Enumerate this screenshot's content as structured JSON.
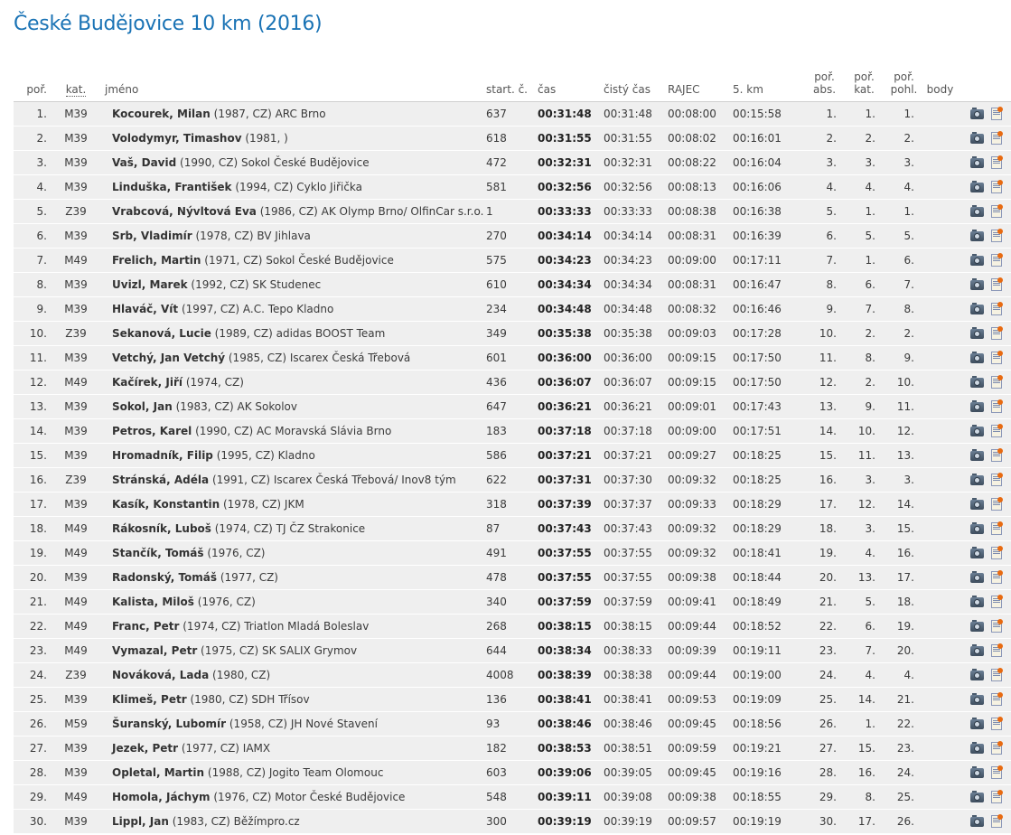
{
  "title": "České Budějovice 10 km (2016)",
  "headers": {
    "rank": "poř.",
    "category": "kat.",
    "name": "jméno",
    "start_no": "start. č.",
    "time": "čas",
    "net_time": "čistý čas",
    "rajec": "RAJEC",
    "km5": "5. km",
    "rank_abs_1": "poř.",
    "rank_abs_2": "abs.",
    "rank_cat_1": "poř.",
    "rank_cat_2": "kat.",
    "rank_gender_1": "poř.",
    "rank_gender_2": "pohl.",
    "points": "body"
  },
  "icons": {
    "photo": "camera-icon",
    "certificate": "certificate-icon"
  },
  "colors": {
    "title": "#1a73b5",
    "row_bg": "#efefef"
  },
  "rows": [
    {
      "rank": "1.",
      "cat": "M39",
      "name": "Kocourek, Milan",
      "info": " (1987, CZ) ARC Brno",
      "start": "637",
      "time": "00:31:48",
      "net": "00:31:48",
      "rajec": "00:08:00",
      "km5": "00:15:58",
      "abs": "1.",
      "katr": "1.",
      "pohl": "1."
    },
    {
      "rank": "2.",
      "cat": "M39",
      "name": "Volodymyr, Timashov",
      "info": " (1981, )",
      "start": "618",
      "time": "00:31:55",
      "net": "00:31:55",
      "rajec": "00:08:02",
      "km5": "00:16:01",
      "abs": "2.",
      "katr": "2.",
      "pohl": "2."
    },
    {
      "rank": "3.",
      "cat": "M39",
      "name": "Vaš, David",
      "info": " (1990, CZ) Sokol České Budějovice",
      "start": "472",
      "time": "00:32:31",
      "net": "00:32:31",
      "rajec": "00:08:22",
      "km5": "00:16:04",
      "abs": "3.",
      "katr": "3.",
      "pohl": "3."
    },
    {
      "rank": "4.",
      "cat": "M39",
      "name": "Linduška, František",
      "info": " (1994, CZ) Cyklo Jiřička",
      "start": "581",
      "time": "00:32:56",
      "net": "00:32:56",
      "rajec": "00:08:13",
      "km5": "00:16:06",
      "abs": "4.",
      "katr": "4.",
      "pohl": "4."
    },
    {
      "rank": "5.",
      "cat": "Z39",
      "name": "Vrabcová, Nývltová Eva",
      "info": " (1986, CZ) AK Olymp Brno/ OlfinCar s.r.o.",
      "start": "1",
      "time": "00:33:33",
      "net": "00:33:33",
      "rajec": "00:08:38",
      "km5": "00:16:38",
      "abs": "5.",
      "katr": "1.",
      "pohl": "1."
    },
    {
      "rank": "6.",
      "cat": "M39",
      "name": "Srb, Vladimír",
      "info": " (1978, CZ) BV Jihlava",
      "start": "270",
      "time": "00:34:14",
      "net": "00:34:14",
      "rajec": "00:08:31",
      "km5": "00:16:39",
      "abs": "6.",
      "katr": "5.",
      "pohl": "5."
    },
    {
      "rank": "7.",
      "cat": "M49",
      "name": "Frelich, Martin",
      "info": " (1971, CZ) Sokol České Budějovice",
      "start": "575",
      "time": "00:34:23",
      "net": "00:34:23",
      "rajec": "00:09:00",
      "km5": "00:17:11",
      "abs": "7.",
      "katr": "1.",
      "pohl": "6."
    },
    {
      "rank": "8.",
      "cat": "M39",
      "name": "Uvizl, Marek",
      "info": " (1992, CZ) SK Studenec",
      "start": "610",
      "time": "00:34:34",
      "net": "00:34:34",
      "rajec": "00:08:31",
      "km5": "00:16:47",
      "abs": "8.",
      "katr": "6.",
      "pohl": "7."
    },
    {
      "rank": "9.",
      "cat": "M39",
      "name": "Hlaváč, Vít",
      "info": " (1997, CZ) A.C. Tepo Kladno",
      "start": "234",
      "time": "00:34:48",
      "net": "00:34:48",
      "rajec": "00:08:32",
      "km5": "00:16:46",
      "abs": "9.",
      "katr": "7.",
      "pohl": "8."
    },
    {
      "rank": "10.",
      "cat": "Z39",
      "name": "Sekanová, Lucie",
      "info": " (1989, CZ) adidas BOOST Team",
      "start": "349",
      "time": "00:35:38",
      "net": "00:35:38",
      "rajec": "00:09:03",
      "km5": "00:17:28",
      "abs": "10.",
      "katr": "2.",
      "pohl": "2."
    },
    {
      "rank": "11.",
      "cat": "M39",
      "name": "Vetchý, Jan Vetchý",
      "info": " (1985, CZ) Iscarex Česká Třebová",
      "start": "601",
      "time": "00:36:00",
      "net": "00:36:00",
      "rajec": "00:09:15",
      "km5": "00:17:50",
      "abs": "11.",
      "katr": "8.",
      "pohl": "9."
    },
    {
      "rank": "12.",
      "cat": "M49",
      "name": "Kačírek, Jiří",
      "info": " (1974, CZ)",
      "start": "436",
      "time": "00:36:07",
      "net": "00:36:07",
      "rajec": "00:09:15",
      "km5": "00:17:50",
      "abs": "12.",
      "katr": "2.",
      "pohl": "10."
    },
    {
      "rank": "13.",
      "cat": "M39",
      "name": "Sokol, Jan",
      "info": " (1983, CZ) AK Sokolov",
      "start": "647",
      "time": "00:36:21",
      "net": "00:36:21",
      "rajec": "00:09:01",
      "km5": "00:17:43",
      "abs": "13.",
      "katr": "9.",
      "pohl": "11."
    },
    {
      "rank": "14.",
      "cat": "M39",
      "name": "Petros, Karel",
      "info": " (1990, CZ) AC Moravská Slávia Brno",
      "start": "183",
      "time": "00:37:18",
      "net": "00:37:18",
      "rajec": "00:09:00",
      "km5": "00:17:51",
      "abs": "14.",
      "katr": "10.",
      "pohl": "12."
    },
    {
      "rank": "15.",
      "cat": "M39",
      "name": "Hromadník, Filip",
      "info": " (1995, CZ) Kladno",
      "start": "586",
      "time": "00:37:21",
      "net": "00:37:21",
      "rajec": "00:09:27",
      "km5": "00:18:25",
      "abs": "15.",
      "katr": "11.",
      "pohl": "13."
    },
    {
      "rank": "16.",
      "cat": "Z39",
      "name": "Stránská, Adéla",
      "info": " (1991, CZ) Iscarex Česká Třebová/ Inov8 tým",
      "start": "622",
      "time": "00:37:31",
      "net": "00:37:30",
      "rajec": "00:09:32",
      "km5": "00:18:25",
      "abs": "16.",
      "katr": "3.",
      "pohl": "3."
    },
    {
      "rank": "17.",
      "cat": "M39",
      "name": "Kasík, Konstantin",
      "info": " (1978, CZ) JKM",
      "start": "318",
      "time": "00:37:39",
      "net": "00:37:37",
      "rajec": "00:09:33",
      "km5": "00:18:29",
      "abs": "17.",
      "katr": "12.",
      "pohl": "14."
    },
    {
      "rank": "18.",
      "cat": "M49",
      "name": "Rákosník, Luboš",
      "info": " (1974, CZ) TJ ČZ Strakonice",
      "start": "87",
      "time": "00:37:43",
      "net": "00:37:43",
      "rajec": "00:09:32",
      "km5": "00:18:29",
      "abs": "18.",
      "katr": "3.",
      "pohl": "15."
    },
    {
      "rank": "19.",
      "cat": "M49",
      "name": "Stančík, Tomáš",
      "info": " (1976, CZ)",
      "start": "491",
      "time": "00:37:55",
      "net": "00:37:55",
      "rajec": "00:09:32",
      "km5": "00:18:41",
      "abs": "19.",
      "katr": "4.",
      "pohl": "16."
    },
    {
      "rank": "20.",
      "cat": "M39",
      "name": "Radonský, Tomáš",
      "info": " (1977, CZ)",
      "start": "478",
      "time": "00:37:55",
      "net": "00:37:55",
      "rajec": "00:09:38",
      "km5": "00:18:44",
      "abs": "20.",
      "katr": "13.",
      "pohl": "17."
    },
    {
      "rank": "21.",
      "cat": "M49",
      "name": "Kalista, Miloš",
      "info": " (1976, CZ)",
      "start": "340",
      "time": "00:37:59",
      "net": "00:37:59",
      "rajec": "00:09:41",
      "km5": "00:18:49",
      "abs": "21.",
      "katr": "5.",
      "pohl": "18."
    },
    {
      "rank": "22.",
      "cat": "M49",
      "name": "Franc, Petr",
      "info": " (1974, CZ) Triatlon Mladá Boleslav",
      "start": "268",
      "time": "00:38:15",
      "net": "00:38:15",
      "rajec": "00:09:44",
      "km5": "00:18:52",
      "abs": "22.",
      "katr": "6.",
      "pohl": "19."
    },
    {
      "rank": "23.",
      "cat": "M49",
      "name": "Vymazal, Petr",
      "info": " (1975, CZ) SK SALIX Grymov",
      "start": "644",
      "time": "00:38:34",
      "net": "00:38:33",
      "rajec": "00:09:39",
      "km5": "00:19:11",
      "abs": "23.",
      "katr": "7.",
      "pohl": "20."
    },
    {
      "rank": "24.",
      "cat": "Z39",
      "name": "Nováková, Lada",
      "info": " (1980, CZ)",
      "start": "4008",
      "time": "00:38:39",
      "net": "00:38:38",
      "rajec": "00:09:44",
      "km5": "00:19:00",
      "abs": "24.",
      "katr": "4.",
      "pohl": "4."
    },
    {
      "rank": "25.",
      "cat": "M39",
      "name": "Klimeš, Petr",
      "info": " (1980, CZ) SDH Třísov",
      "start": "136",
      "time": "00:38:41",
      "net": "00:38:41",
      "rajec": "00:09:53",
      "km5": "00:19:09",
      "abs": "25.",
      "katr": "14.",
      "pohl": "21."
    },
    {
      "rank": "26.",
      "cat": "M59",
      "name": "Šuranský, Lubomír",
      "info": " (1958, CZ) JH Nové Stavení",
      "start": "93",
      "time": "00:38:46",
      "net": "00:38:46",
      "rajec": "00:09:45",
      "km5": "00:18:56",
      "abs": "26.",
      "katr": "1.",
      "pohl": "22."
    },
    {
      "rank": "27.",
      "cat": "M39",
      "name": "Jezek, Petr",
      "info": " (1977, CZ) IAMX",
      "start": "182",
      "time": "00:38:53",
      "net": "00:38:51",
      "rajec": "00:09:59",
      "km5": "00:19:21",
      "abs": "27.",
      "katr": "15.",
      "pohl": "23."
    },
    {
      "rank": "28.",
      "cat": "M39",
      "name": "Opletal, Martin",
      "info": " (1988, CZ) Jogito Team Olomouc",
      "start": "603",
      "time": "00:39:06",
      "net": "00:39:05",
      "rajec": "00:09:45",
      "km5": "00:19:16",
      "abs": "28.",
      "katr": "16.",
      "pohl": "24."
    },
    {
      "rank": "29.",
      "cat": "M49",
      "name": "Homola, Jáchym",
      "info": " (1976, CZ) Motor České Budějovice",
      "start": "548",
      "time": "00:39:11",
      "net": "00:39:08",
      "rajec": "00:09:38",
      "km5": "00:18:55",
      "abs": "29.",
      "katr": "8.",
      "pohl": "25."
    },
    {
      "rank": "30.",
      "cat": "M39",
      "name": "Lippl, Jan",
      "info": " (1983, CZ) Běžímpro.cz",
      "start": "300",
      "time": "00:39:19",
      "net": "00:39:19",
      "rajec": "00:09:57",
      "km5": "00:19:19",
      "abs": "30.",
      "katr": "17.",
      "pohl": "26."
    }
  ]
}
